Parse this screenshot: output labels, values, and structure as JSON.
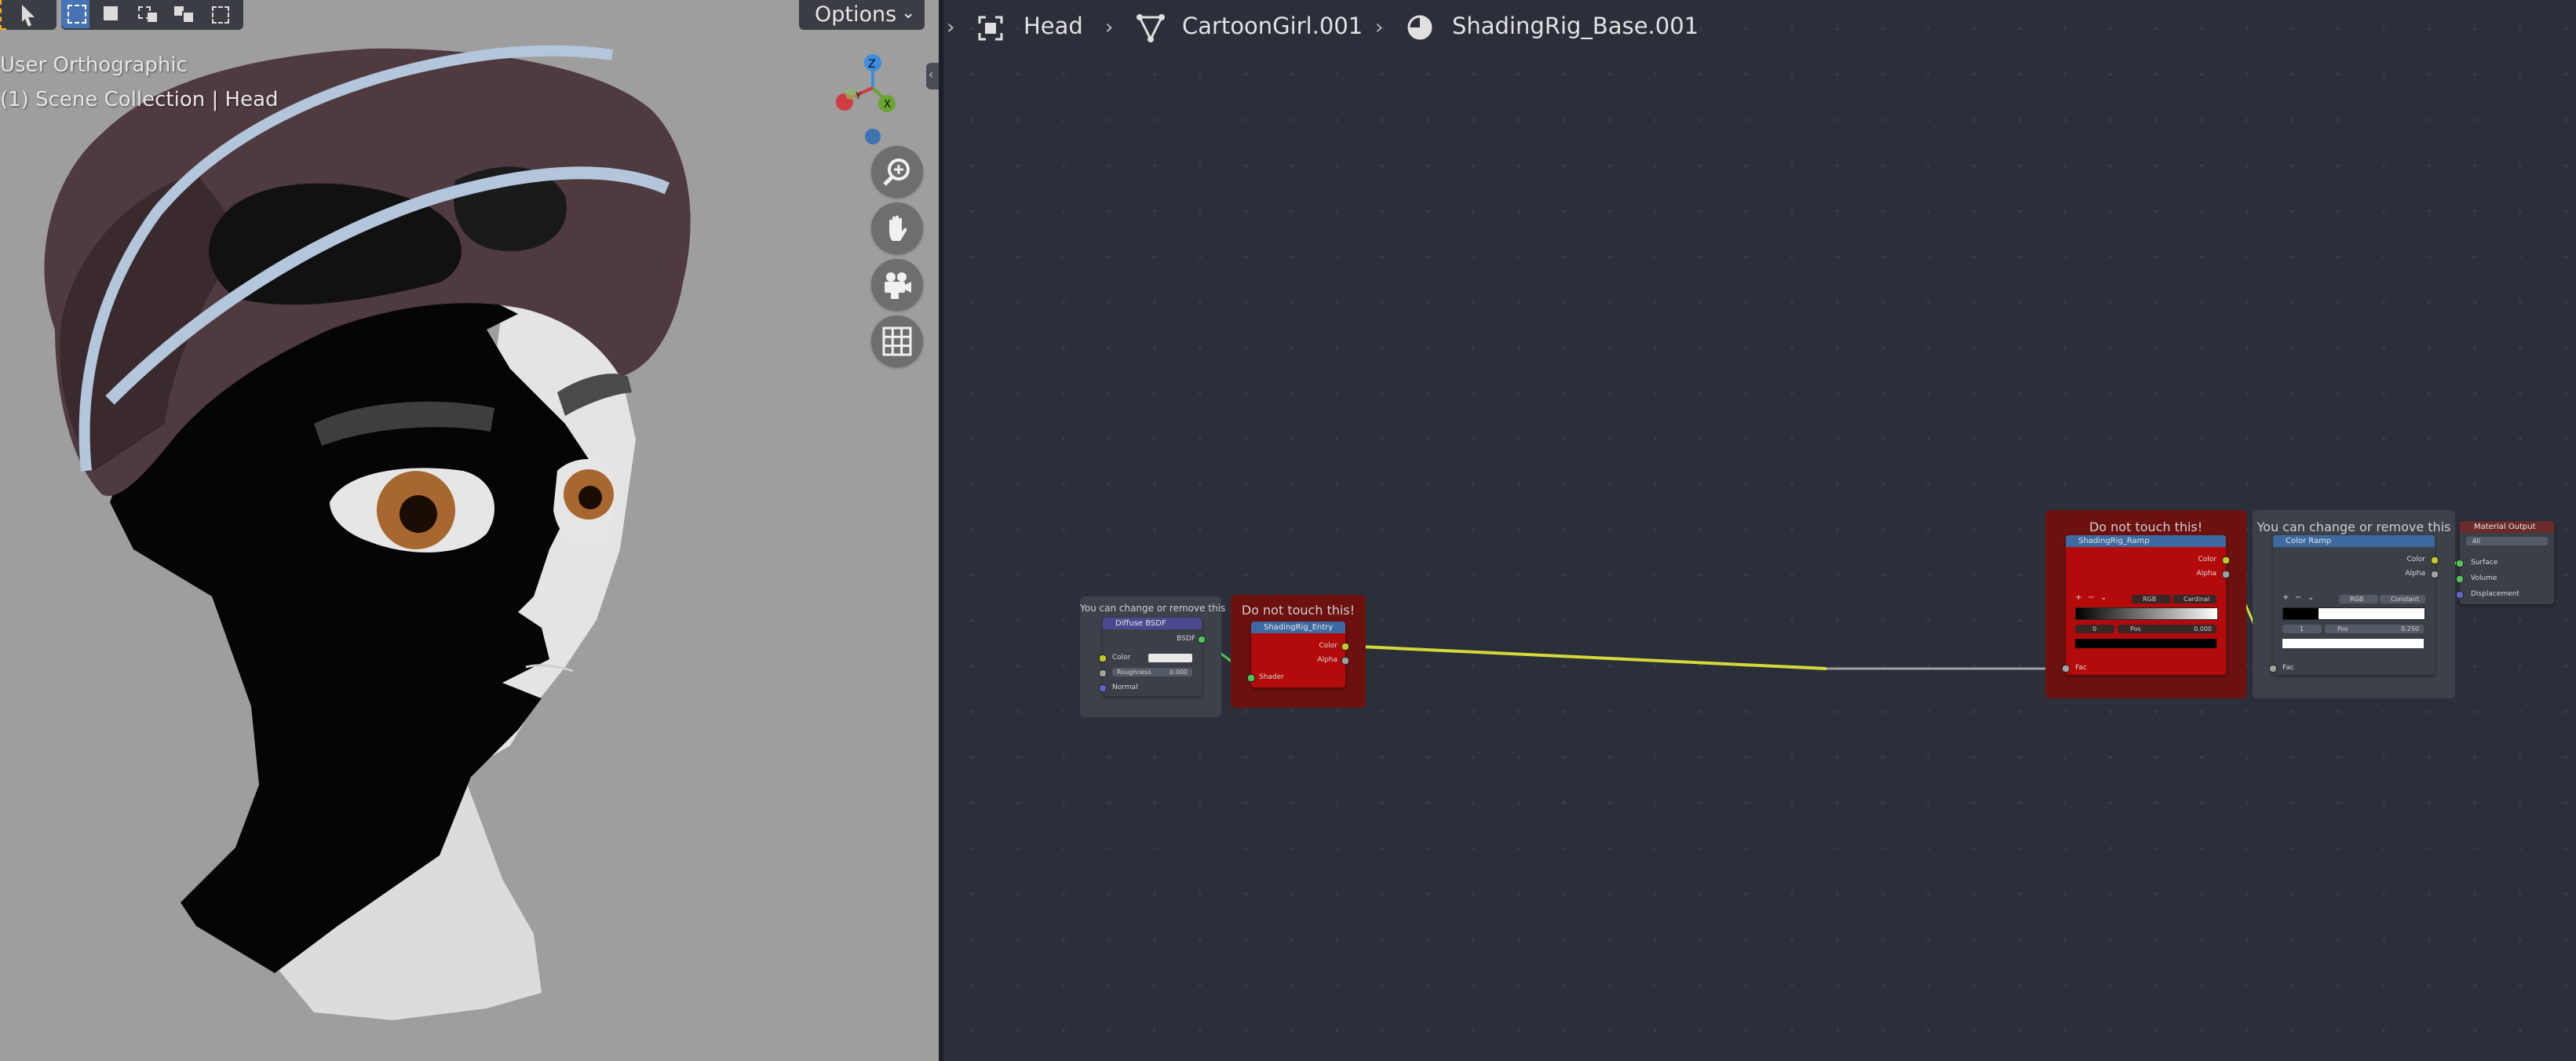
{
  "viewport": {
    "options_label": "Options",
    "view_name": "User Orthographic",
    "collection_info": "(1) Scene Collection | Head",
    "gizmo_axes": [
      "Z",
      "Y",
      "X"
    ],
    "nav_buttons": [
      "zoom-icon",
      "pan-hand-icon",
      "camera-icon",
      "grid-icon"
    ]
  },
  "breadcrumb": {
    "object": "Head",
    "mesh": "CartoonGirl.001",
    "material": "ShadingRig_Base.001"
  },
  "nodes": {
    "frame_diffuse_label": "You can change or remove this",
    "diffuse": {
      "title": "Diffuse BSDF",
      "out_bsdf": "BSDF",
      "in_color": "Color",
      "roughness_label": "Roughness",
      "roughness_value": "0.000",
      "in_normal": "Normal"
    },
    "frame_entry_label": "Do not touch this!",
    "entry": {
      "title": "ShadingRig_Entry",
      "out_color": "Color",
      "out_alpha": "Alpha",
      "in_shader": "Shader"
    },
    "frame_ramp_label": "Do not touch this!",
    "ramp": {
      "title": "ShadingRig_Ramp",
      "out_color": "Color",
      "out_alpha": "Alpha",
      "mode": "RGB",
      "interp": "Cardinal",
      "index": "0",
      "pos_label": "Pos",
      "pos_value": "0.000",
      "in_fac": "Fac"
    },
    "frame_color_label": "You can change or remove this",
    "colorramp": {
      "title": "Color Ramp",
      "out_color": "Color",
      "out_alpha": "Alpha",
      "mode": "RGB",
      "interp": "Constant",
      "index": "1",
      "pos_label": "Pos",
      "pos_value": "0.250",
      "in_fac": "Fac"
    },
    "output": {
      "title": "Material Output",
      "target": "All",
      "in_surface": "Surface",
      "in_volume": "Volume",
      "in_displacement": "Displacement"
    }
  },
  "colors": {
    "frame_red": "#6d1010",
    "node_red": "#b30b0b",
    "frame_gray": "#3c414a",
    "link_yellow": "#d6d83a",
    "link_green": "#4fc35a",
    "link_gray": "#a0a0a0",
    "header_blue": "#3d6aa0",
    "header_purple": "#4b4a8f"
  }
}
